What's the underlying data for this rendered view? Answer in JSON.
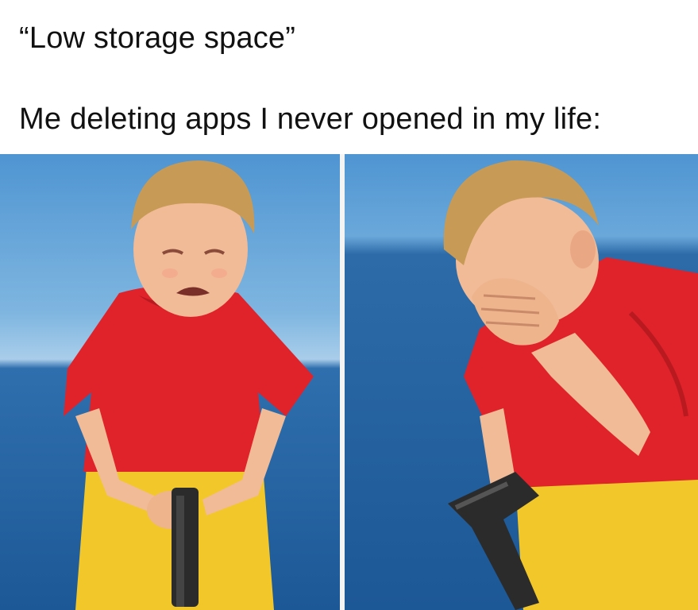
{
  "caption": {
    "line1": "“Low storage space”",
    "line2": "Me deleting apps I never opened in my life:"
  },
  "colors": {
    "background": "#ffffff",
    "text": "#111111",
    "sky": "#5b9fd6",
    "sea": "#1f5e9c",
    "shirt": "#e0232a",
    "shorts": "#f2c72a",
    "hair": "#c79a55",
    "skin": "#f0bb96",
    "gun": "#2b2b2b"
  },
  "panels": [
    {
      "subject": "crying-child-holding-gun"
    },
    {
      "subject": "child-covering-face-with-hand"
    }
  ]
}
